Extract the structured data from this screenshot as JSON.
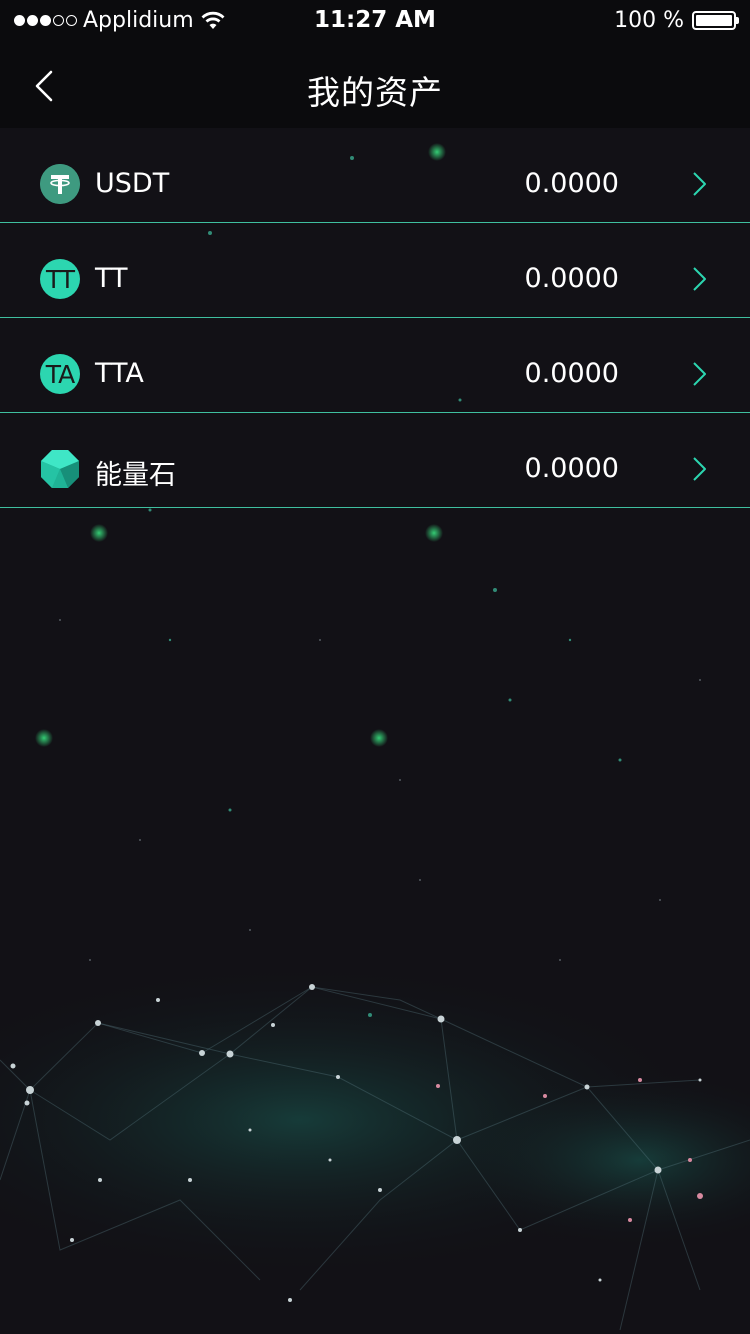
{
  "status_bar": {
    "carrier": "Applidium",
    "time": "11:27 AM",
    "battery": "100 %",
    "battery_level": 1.0,
    "signal_bars": 3,
    "signal_total": 5,
    "wifi_icon": "wifi-icon"
  },
  "nav": {
    "title": "我的资产",
    "back_icon": "chevron-left-icon"
  },
  "assets": [
    {
      "name": "USDT",
      "amount": "0.0000",
      "icon": "usdt-icon",
      "icon_text": ""
    },
    {
      "name": "TT",
      "amount": "0.0000",
      "icon": "tt-icon",
      "icon_text": "TT"
    },
    {
      "name": "TTA",
      "amount": "0.0000",
      "icon": "tta-icon",
      "icon_text": "TA"
    },
    {
      "name": "能量石",
      "amount": "0.0000",
      "icon": "energy-stone-icon",
      "icon_text": ""
    }
  ],
  "colors": {
    "background": "#121116",
    "bar_background": "#0b0b0d",
    "divider": "#3fbf9f",
    "accent": "#2cd6b0",
    "usdt": "#3e9a80"
  }
}
